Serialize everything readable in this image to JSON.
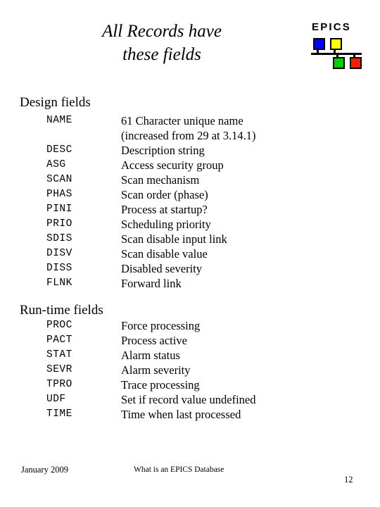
{
  "slide": {
    "title_line1": "All Records have",
    "title_line2": "these fields"
  },
  "logo": {
    "wordmark": "EPICS",
    "colors": {
      "blue": "#0000ff",
      "yellow": "#ffff00",
      "green": "#00d000",
      "red": "#ee2200",
      "wire": "#000000"
    }
  },
  "sections": {
    "design": {
      "heading": "Design fields",
      "fields": [
        {
          "name": "NAME",
          "desc": "61 Character unique name",
          "desc2": "(increased from 29 at 3.14.1)"
        },
        {
          "name": "DESC",
          "desc": "Description string"
        },
        {
          "name": "ASG",
          "desc": "Access security group"
        },
        {
          "name": "SCAN",
          "desc": "Scan mechanism"
        },
        {
          "name": "PHAS",
          "desc": "Scan order (phase)"
        },
        {
          "name": "PINI",
          "desc": "Process at startup?"
        },
        {
          "name": "PRIO",
          "desc": "Scheduling priority"
        },
        {
          "name": "SDIS",
          "desc": "Scan disable input link"
        },
        {
          "name": "DISV",
          "desc": "Scan disable value"
        },
        {
          "name": "DISS",
          "desc": "Disabled severity"
        },
        {
          "name": "FLNK",
          "desc": "Forward link"
        }
      ]
    },
    "runtime": {
      "heading": "Run-time fields",
      "fields": [
        {
          "name": "PROC",
          "desc": "Force processing"
        },
        {
          "name": "PACT",
          "desc": "Process active"
        },
        {
          "name": "STAT",
          "desc": "Alarm status"
        },
        {
          "name": "SEVR",
          "desc": "Alarm severity"
        },
        {
          "name": "TPRO",
          "desc": "Trace processing"
        },
        {
          "name": "UDF",
          "desc": "Set if record value undefined"
        },
        {
          "name": "TIME",
          "desc": "Time when last processed"
        }
      ]
    }
  },
  "footer": {
    "date": "January 2009",
    "center": "What is an EPICS Database",
    "page_number": "12"
  }
}
